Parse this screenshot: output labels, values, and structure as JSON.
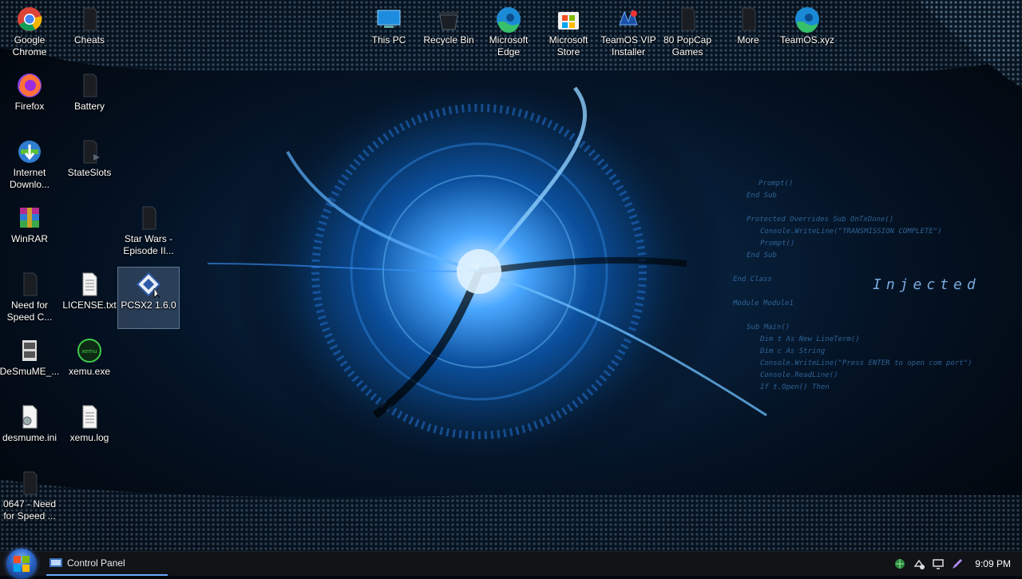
{
  "desktop": {
    "wallpaper_text": [
      "Prompt()",
      "End Sub",
      "Protected Overrides Sub OnTxDone()",
      "Console.WriteLine(\"TRANSMISSION COMPLETE\")",
      "Prompt()",
      "End Sub",
      "End Class",
      "Module Module1",
      "Sub Main()",
      "Dim t As New LineTerm()",
      "Dim c As String",
      "Console.WriteLine(\"Press ENTER to open com port\")",
      "Console.ReadLine()",
      "If t.Open() Then"
    ],
    "wallpaper_title": "Injected",
    "icons": [
      {
        "id": "chrome",
        "label": "Google\nChrome",
        "icon": "chrome-icon"
      },
      {
        "id": "cheats",
        "label": "Cheats",
        "icon": "file-icon"
      },
      {
        "id": "thispc",
        "label": "This PC",
        "icon": "computer-icon"
      },
      {
        "id": "recycle",
        "label": "Recycle Bin",
        "icon": "recycle-bin-icon"
      },
      {
        "id": "edge",
        "label": "Microsoft\nEdge",
        "icon": "edge-icon"
      },
      {
        "id": "store",
        "label": "Microsoft\nStore",
        "icon": "store-icon"
      },
      {
        "id": "teamosvip",
        "label": "TeamOS VIP\nInstaller",
        "icon": "installer-icon"
      },
      {
        "id": "popcap",
        "label": "80 PopCap\nGames",
        "icon": "file-icon"
      },
      {
        "id": "more",
        "label": "More",
        "icon": "file-icon"
      },
      {
        "id": "teamosxyz",
        "label": "TeamOS.xyz",
        "icon": "edge-icon"
      },
      {
        "id": "firefox",
        "label": "Firefox",
        "icon": "firefox-icon"
      },
      {
        "id": "battery",
        "label": "Battery",
        "icon": "file-icon"
      },
      {
        "id": "idm",
        "label": "Internet\nDownlo...",
        "icon": "internet-download-icon"
      },
      {
        "id": "stateslots",
        "label": "StateSlots",
        "icon": "file-icon"
      },
      {
        "id": "winrar",
        "label": "WinRAR",
        "icon": "winrar-icon"
      },
      {
        "id": "starwars",
        "label": "Star Wars -\nEpisode II...",
        "icon": "file-icon"
      },
      {
        "id": "nfs",
        "label": "Need for\nSpeed C...",
        "icon": "file-icon"
      },
      {
        "id": "license",
        "label": "LICENSE.txt",
        "icon": "text-file-icon"
      },
      {
        "id": "pcsx2",
        "label": "PCSX2 1.6.0",
        "icon": "pcsx2-icon"
      },
      {
        "id": "desmume",
        "label": "DeSmuME_...",
        "icon": "desmume-icon"
      },
      {
        "id": "xemu",
        "label": "xemu.exe",
        "icon": "xemu-icon"
      },
      {
        "id": "desmumeini",
        "label": "desmume.ini",
        "icon": "settings-file-icon"
      },
      {
        "id": "xemulog",
        "label": "xemu.log",
        "icon": "text-file-icon"
      },
      {
        "id": "nfs0647",
        "label": "0647 - Need\nfor Speed ...",
        "icon": "file-icon"
      }
    ]
  },
  "taskbar": {
    "start_icon": "windows-start-icon",
    "active_window": "Control Panel",
    "tray_icons": [
      "network-icon",
      "action-center-icon",
      "display-icon",
      "pen-icon"
    ],
    "clock": "9:09 PM"
  },
  "colors": {
    "accent": "#3a8cff",
    "taskbar": "#111317"
  }
}
